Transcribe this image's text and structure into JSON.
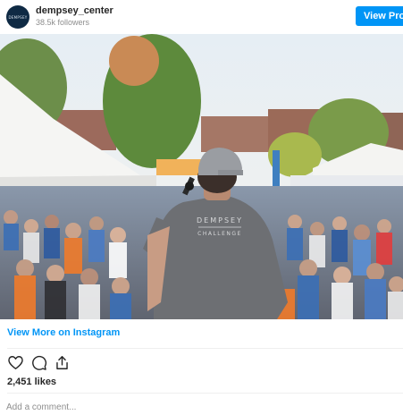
{
  "header": {
    "avatar_text": "DEMPSEY",
    "username": "dempsey_center",
    "followers": "38.5k followers",
    "view_profile_label": "View Profile"
  },
  "photo": {
    "shirt_line1": "DEMPSEY",
    "shirt_line2": "CHALLENGE"
  },
  "view_more_label": "View More on Instagram",
  "actions": [
    "heart-icon",
    "comment-icon",
    "share-icon"
  ],
  "likes": "2,451 likes",
  "comment": {
    "placeholder": "Add a comment..."
  },
  "colors": {
    "accent": "#0095f6",
    "text": "#262626",
    "muted": "#8e8e8e"
  }
}
